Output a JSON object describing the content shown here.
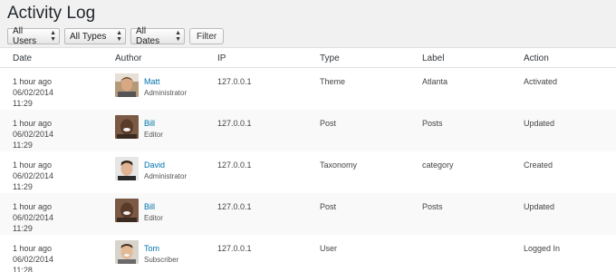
{
  "page": {
    "title": "Activity Log"
  },
  "filters": {
    "users": "All Users",
    "types": "All Types",
    "dates": "All Dates",
    "filter_button": "Filter"
  },
  "table": {
    "headers": {
      "date": "Date",
      "author": "Author",
      "ip": "IP",
      "type": "Type",
      "label": "Label",
      "action": "Action"
    },
    "rows": [
      {
        "date_rel": "1 hour ago",
        "date": "06/02/2014",
        "time": "11:29",
        "author": "Matt",
        "role": "Administrator",
        "avatar": "matt",
        "ip": "127.0.0.1",
        "type": "Theme",
        "label": "Atlanta",
        "action": "Activated"
      },
      {
        "date_rel": "1 hour ago",
        "date": "06/02/2014",
        "time": "11:29",
        "author": "Bill",
        "role": "Editor",
        "avatar": "bill",
        "ip": "127.0.0.1",
        "type": "Post",
        "label": "Posts",
        "action": "Updated"
      },
      {
        "date_rel": "1 hour ago",
        "date": "06/02/2014",
        "time": "11:29",
        "author": "David",
        "role": "Administrator",
        "avatar": "david",
        "ip": "127.0.0.1",
        "type": "Taxonomy",
        "label": "category",
        "action": "Created"
      },
      {
        "date_rel": "1 hour ago",
        "date": "06/02/2014",
        "time": "11:29",
        "author": "Bill",
        "role": "Editor",
        "avatar": "bill",
        "ip": "127.0.0.1",
        "type": "Post",
        "label": "Posts",
        "action": "Updated"
      },
      {
        "date_rel": "1 hour ago",
        "date": "06/02/2014",
        "time": "11:28",
        "author": "Tom",
        "role": "Subscriber",
        "avatar": "tom",
        "ip": "127.0.0.1",
        "type": "User",
        "label": "",
        "action": "Logged In"
      }
    ]
  },
  "colors": {
    "link": "#0073aa",
    "row_alt": "#f9f9f9",
    "background": "#f1f1f1"
  }
}
